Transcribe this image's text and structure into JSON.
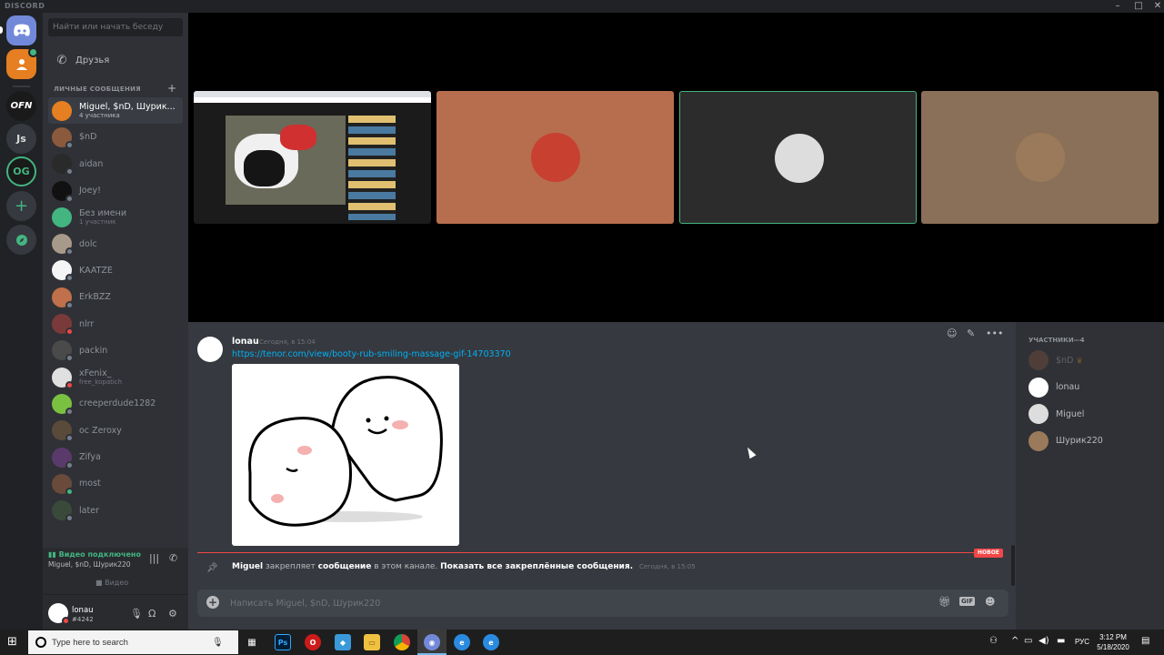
{
  "app": {
    "brand": "DISCORD"
  },
  "servers": [
    {
      "id": "ofn",
      "label": "OFN",
      "color": "#1a1a1a"
    },
    {
      "id": "js",
      "label": "Js",
      "color": "#36393f"
    },
    {
      "id": "og",
      "label": "OG",
      "color": "#1a1a1a"
    }
  ],
  "dms": {
    "search_placeholder": "Найти или начать беседу",
    "friends_label": "Друзья",
    "header": "ЛИЧНЫЕ СООБЩЕНИЯ",
    "items": [
      {
        "name": "Miguel, $nD, Шурик...",
        "sub": "4 участника",
        "color": "#e67e22",
        "status": ""
      },
      {
        "name": "$nD",
        "sub": "",
        "color": "#8b5a3c",
        "status": "#747f8d"
      },
      {
        "name": "aidan",
        "sub": "",
        "color": "#2a2a2a",
        "status": "#747f8d"
      },
      {
        "name": "Joey!",
        "sub": "",
        "color": "#111111",
        "status": "#747f8d"
      },
      {
        "name": "Без имени",
        "sub": "1 участник",
        "color": "#43b581",
        "status": ""
      },
      {
        "name": "dolc",
        "sub": "",
        "color": "#a89a8a",
        "status": "#747f8d"
      },
      {
        "name": "KAATZE",
        "sub": "",
        "color": "#f5f5f5",
        "status": "#747f8d"
      },
      {
        "name": "ErkBZZ",
        "sub": "",
        "color": "#c0704a",
        "status": "#747f8d"
      },
      {
        "name": "nlrr",
        "sub": "",
        "color": "#7a3a3a",
        "status": "#f04747"
      },
      {
        "name": "packin",
        "sub": "",
        "color": "#4a4a4a",
        "status": "#747f8d"
      },
      {
        "name": "xFenix_",
        "sub": "free_kopatich",
        "color": "#e0e0e0",
        "status": "#f04747"
      },
      {
        "name": "creeperdude1282",
        "sub": "",
        "color": "#7ac142",
        "status": "#747f8d"
      },
      {
        "name": "oc Zeroxy",
        "sub": "",
        "color": "#5a4a3a",
        "status": "#747f8d"
      },
      {
        "name": "Zifya",
        "sub": "",
        "color": "#5a3a6a",
        "status": "#747f8d"
      },
      {
        "name": "most",
        "sub": "",
        "color": "#6a4a3a",
        "status": "#43b581"
      },
      {
        "name": "later",
        "sub": "",
        "color": "#3a4a3a",
        "status": "#747f8d"
      }
    ]
  },
  "voice": {
    "status": "Видео подключено",
    "members": "Miguel, $nD, Шурик220",
    "video_label": "Видео"
  },
  "user": {
    "name": "lonau",
    "tag": "#4242"
  },
  "video_tiles": [
    {
      "id": "screenshare",
      "bg": "#1b1b1b",
      "highlight": false
    },
    {
      "id": "snd",
      "bg": "#b76e4e",
      "highlight": false,
      "face": "#c84030"
    },
    {
      "id": "miguel",
      "bg": "#2c2c2c",
      "highlight": true,
      "face": "#dddddd"
    },
    {
      "id": "shurik",
      "bg": "#8a7058",
      "highlight": false,
      "face": "#9a7a5a"
    }
  ],
  "chat": {
    "message": {
      "author": "lonau",
      "time": "Сегодня, в 15:04",
      "link": "https://tenor.com/view/booty-rub-smiling-massage-gif-14703370"
    },
    "new_badge": "НОВОЕ",
    "system": {
      "author": "Miguel",
      "action": "закрепляет",
      "object": "сообщение",
      "middle": "в этом канале.",
      "link": "Показать все закреплённые сообщения.",
      "time": "Сегодня, в 15:05"
    },
    "composer_placeholder": "Написать Miguel, $nD, Шурик220",
    "gif_label": "GIF"
  },
  "members": {
    "header": "УЧАСТНИКИ—4",
    "items": [
      {
        "name": "$nD",
        "color": "#8b5a3c",
        "idle": true,
        "owner": true
      },
      {
        "name": "lonau",
        "color": "#ffffff",
        "idle": false,
        "owner": false
      },
      {
        "name": "Miguel",
        "color": "#dddddd",
        "idle": false,
        "owner": false
      },
      {
        "name": "Шурик220",
        "color": "#9a7a5a",
        "idle": false,
        "owner": false
      }
    ]
  },
  "taskbar": {
    "search_placeholder": "Type here to search",
    "lang": "РУС",
    "time": "3:12 PM",
    "date": "5/18/2020"
  },
  "colors": {
    "blurple": "#7289da",
    "online": "#43b581",
    "dnd": "#f04747",
    "link": "#00b0f4"
  }
}
